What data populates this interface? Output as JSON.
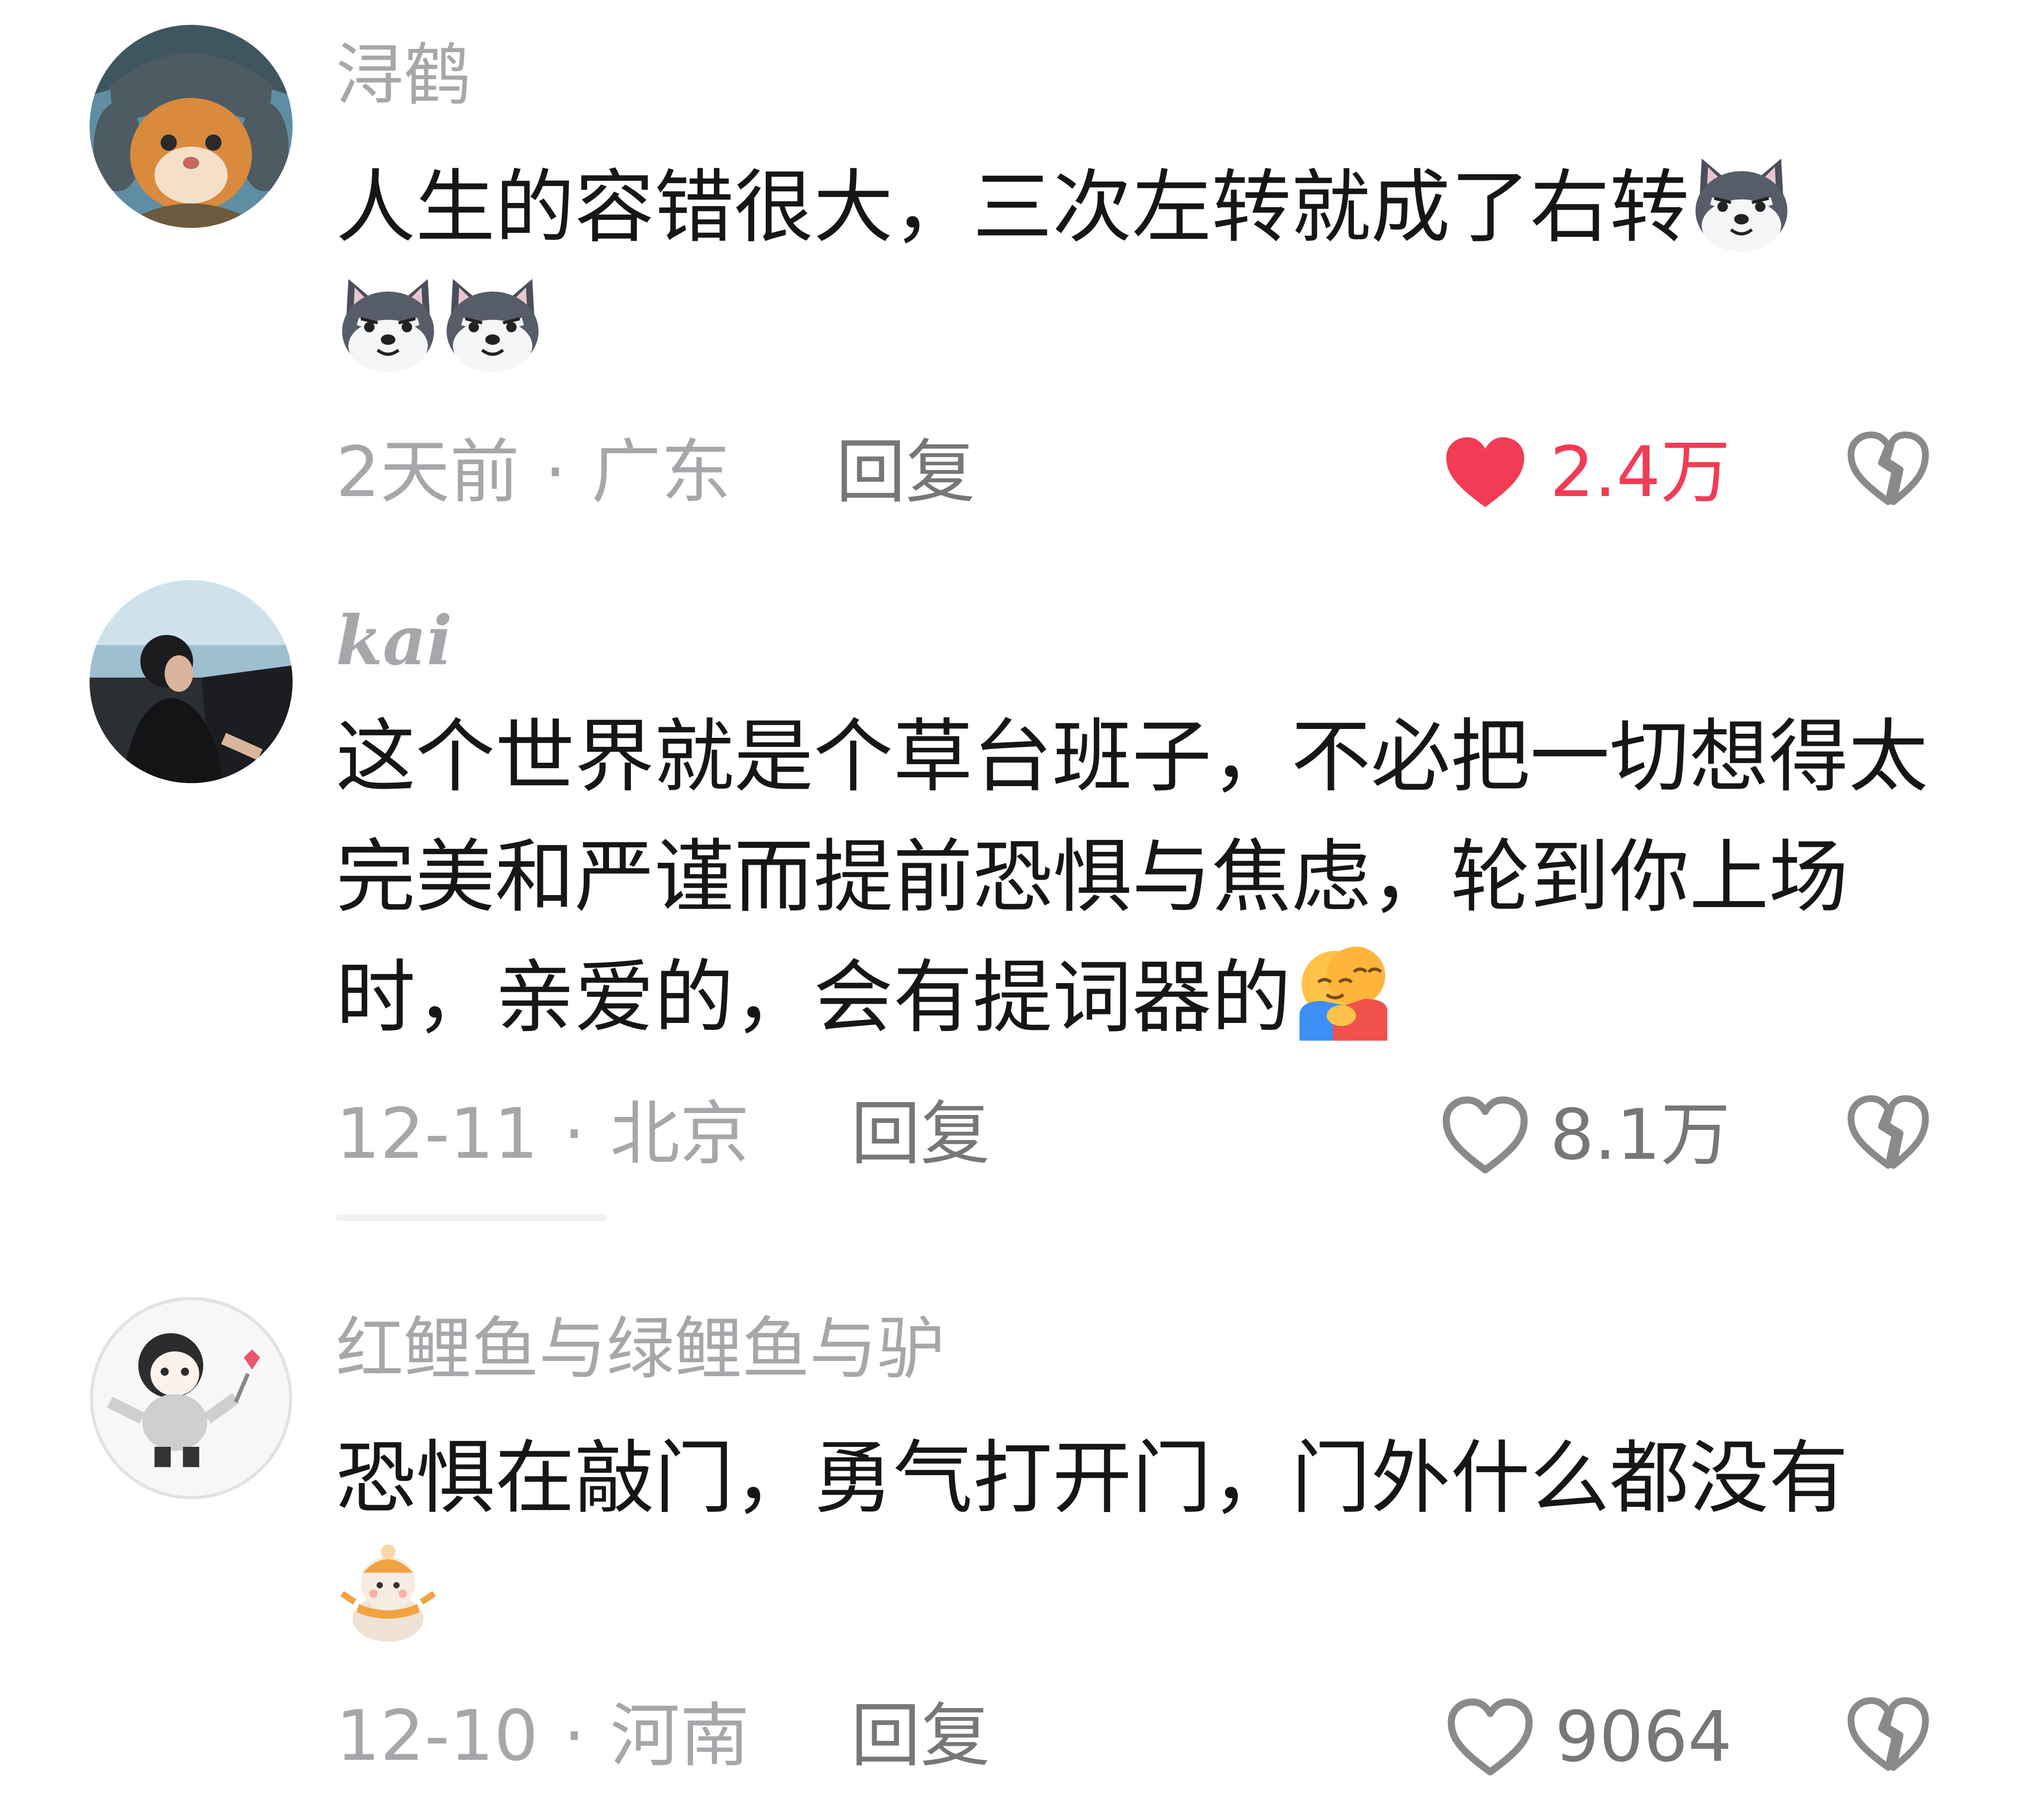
{
  "comments": [
    {
      "username": "浔鹤",
      "text": "人生的容错很大，三次左转就成了右转",
      "emojis": [
        "husky-emoji",
        "husky-emoji",
        "husky-emoji"
      ],
      "time": "2天前",
      "location": "广东",
      "reply_label": "回复",
      "likes": "2.4万",
      "liked": true
    },
    {
      "username": "kai",
      "text": "这个世界就是个草台班子，不必把一切想得太完美和严谨而提前恐惧与焦虑，轮到你上场时，亲爱的，会有提词器的",
      "emojis": [
        "hug-emoji"
      ],
      "time": "12-11",
      "location": "北京",
      "reply_label": "回复",
      "likes": "8.1万",
      "liked": false
    },
    {
      "username": "红鲤鱼与绿鲤鱼与驴",
      "text": "恐惧在敲门，勇气打开门，门外什么都没有",
      "emojis": [
        "snowman-emoji"
      ],
      "time": "12-10",
      "location": "河南",
      "reply_label": "回复",
      "likes": "9064",
      "liked": false
    }
  ],
  "separator": "·",
  "colors": {
    "liked": "#f23c56",
    "meta": "#a7a7ab",
    "text": "#161616"
  }
}
